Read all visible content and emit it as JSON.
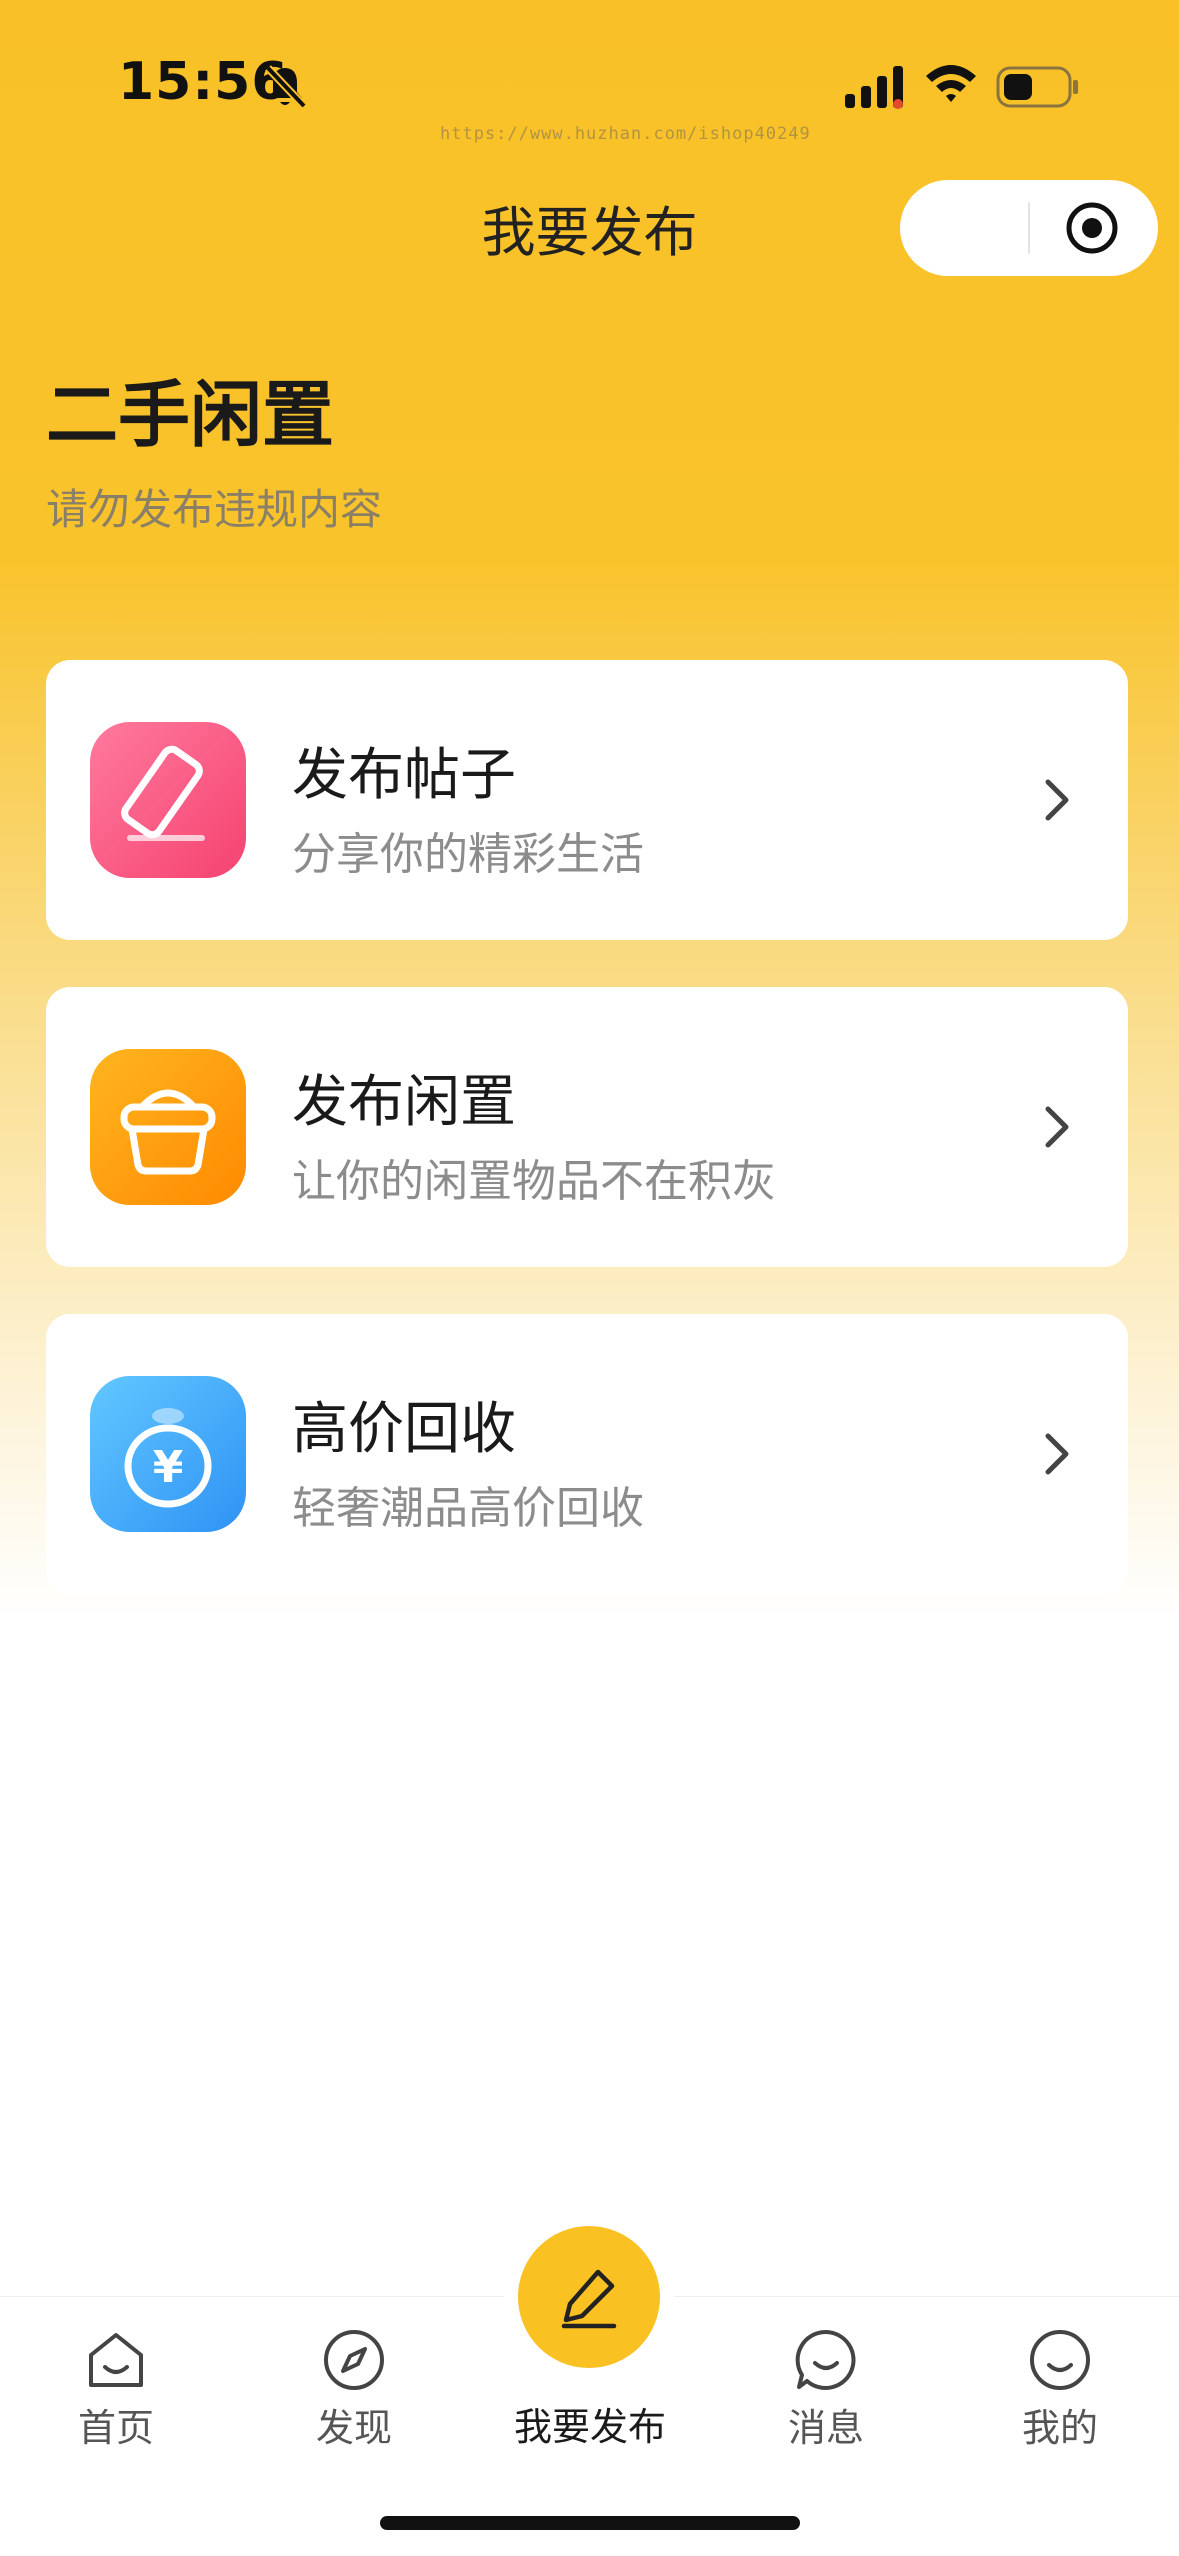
{
  "status_bar": {
    "time": "15:56",
    "watermark": "https://www.huzhan.com/ishop40249"
  },
  "nav": {
    "title": "我要发布"
  },
  "header": {
    "title": "二手闲置",
    "subtitle": "请勿发布违规内容"
  },
  "cards": [
    {
      "title": "发布帖子",
      "desc": "分享你的精彩生活",
      "icon": "pencil-icon",
      "color": "#F54370"
    },
    {
      "title": "发布闲置",
      "desc": "让你的闲置物品不在积灰",
      "icon": "basket-icon",
      "color": "#FF8A00"
    },
    {
      "title": "高价回收",
      "desc": "轻奢潮品高价回收",
      "icon": "money-bag-icon",
      "color": "#2F92F5"
    }
  ],
  "tabbar": {
    "tabs": [
      {
        "label": "首页",
        "icon": "home-icon"
      },
      {
        "label": "发现",
        "icon": "compass-icon"
      },
      {
        "label": "我要发布",
        "icon": "pencil-icon",
        "active": true
      },
      {
        "label": "消息",
        "icon": "chat-icon"
      },
      {
        "label": "我的",
        "icon": "profile-icon"
      }
    ],
    "accent": "#F9C121"
  }
}
